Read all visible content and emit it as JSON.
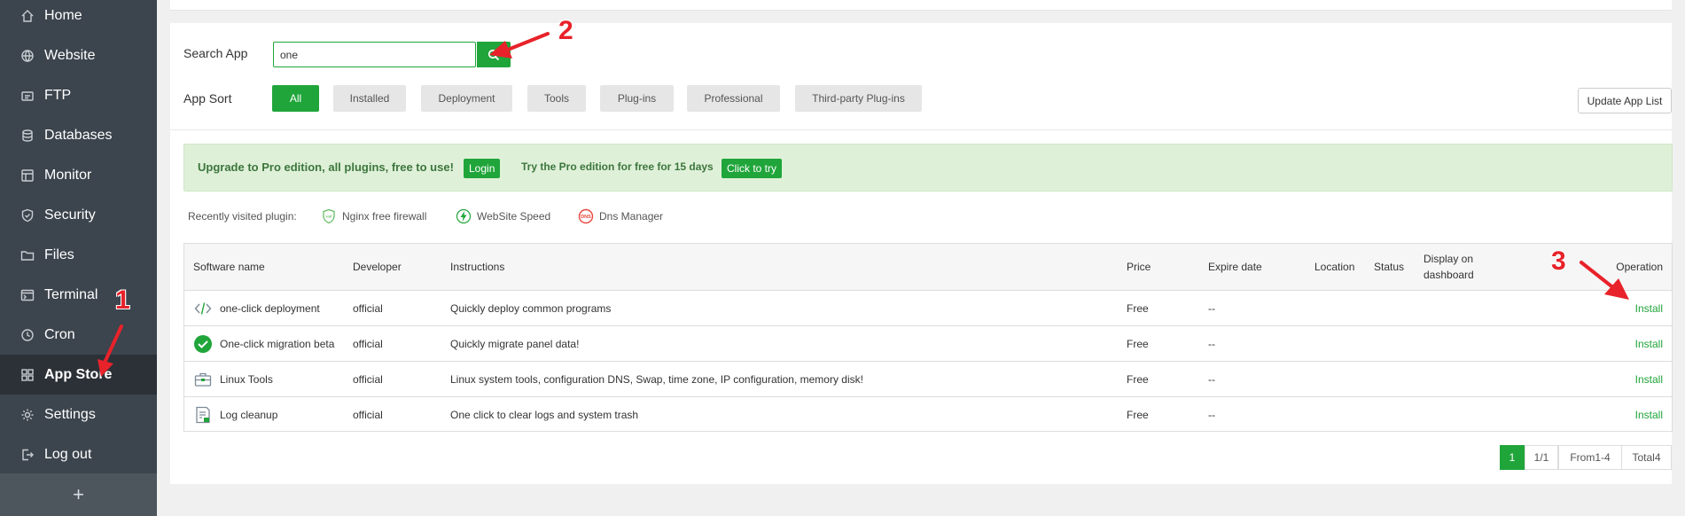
{
  "sidebar": {
    "items": [
      {
        "label": "Home",
        "icon": "home-icon"
      },
      {
        "label": "Website",
        "icon": "globe-icon"
      },
      {
        "label": "FTP",
        "icon": "ftp-icon"
      },
      {
        "label": "Databases",
        "icon": "database-icon"
      },
      {
        "label": "Monitor",
        "icon": "monitor-icon"
      },
      {
        "label": "Security",
        "icon": "shield-icon"
      },
      {
        "label": "Files",
        "icon": "folder-icon"
      },
      {
        "label": "Terminal",
        "icon": "terminal-icon"
      },
      {
        "label": "Cron",
        "icon": "clock-icon"
      },
      {
        "label": "App Store",
        "icon": "grid-icon",
        "active": true
      },
      {
        "label": "Settings",
        "icon": "gear-icon"
      },
      {
        "label": "Log out",
        "icon": "logout-icon"
      }
    ],
    "add_label": "+"
  },
  "search": {
    "label": "Search App",
    "value": "one"
  },
  "sort": {
    "label": "App Sort",
    "options": [
      "All",
      "Installed",
      "Deployment",
      "Tools",
      "Plug-ins",
      "Professional",
      "Third-party Plug-ins"
    ],
    "selected": "All"
  },
  "update_button": "Update App List",
  "pro_banner": {
    "text": "Upgrade to Pro edition, all plugins, free to use!",
    "login_label": "Login",
    "trial_text": "Try the Pro edition for free for 15 days",
    "try_label": "Click to try"
  },
  "recent": {
    "label": "Recently visited plugin:",
    "items": [
      "Nginx free firewall",
      "WebSite Speed",
      "Dns Manager"
    ],
    "dns_badge": "DNS"
  },
  "table": {
    "headers": {
      "software_name": "Software name",
      "developer": "Developer",
      "instructions": "Instructions",
      "price": "Price",
      "expire_date": "Expire date",
      "location": "Location",
      "status": "Status",
      "display_line1": "Display on",
      "display_line2": "dashboard",
      "operation": "Operation"
    },
    "rows": [
      {
        "name": "one-click deployment",
        "developer": "official",
        "instructions": "Quickly deploy common programs",
        "price": "Free",
        "expire": "--",
        "operation": "Install",
        "icon": "code-icon"
      },
      {
        "name": "One-click migration beta",
        "developer": "official",
        "instructions": "Quickly migrate panel data!",
        "price": "Free",
        "expire": "--",
        "operation": "Install",
        "icon": "check-circle-icon"
      },
      {
        "name": "Linux Tools",
        "developer": "official",
        "instructions": "Linux system tools, configuration DNS, Swap, time zone, IP configuration, memory disk!",
        "price": "Free",
        "expire": "--",
        "operation": "Install",
        "icon": "toolbox-icon"
      },
      {
        "name": "Log cleanup",
        "developer": "official",
        "instructions": "One click to clear logs and system trash",
        "price": "Free",
        "expire": "--",
        "operation": "Install",
        "icon": "log-icon"
      }
    ]
  },
  "pagination": {
    "current": "1",
    "pages": "1/1",
    "range": "From1-4",
    "total": "Total4"
  },
  "annotations": {
    "step1": "1",
    "step2": "2",
    "step3": "3"
  },
  "colors": {
    "accent": "#20a53a",
    "sidebar_bg": "#3c444d",
    "annotation": "#e8222a"
  }
}
